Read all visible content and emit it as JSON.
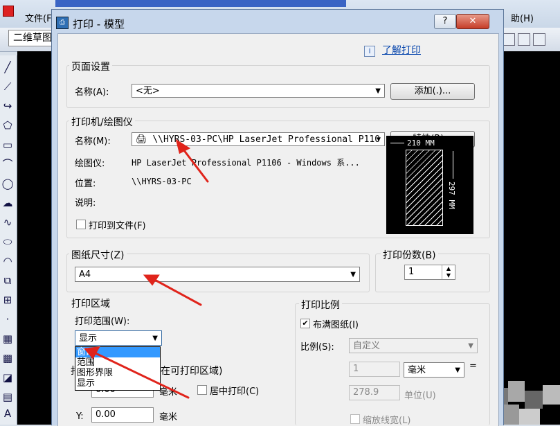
{
  "app": {
    "menu_file": "文件(F",
    "menu_help": "助(H)",
    "workspace": "二维草图"
  },
  "dialog": {
    "title": "打印 - 模型",
    "help_glyph": "?",
    "close_glyph": "✕",
    "learn_link": "了解打印",
    "info_icon": "i"
  },
  "page_setup": {
    "title": "页面设置",
    "name_label": "名称(A):",
    "name_value": "<无>",
    "add_button": "添加(.)..."
  },
  "printer": {
    "title": "打印机/绘图仪",
    "name_label": "名称(M):",
    "name_value": "\\\\HYRS-03-PC\\HP LaserJet Professional P110",
    "properties_button": "特性(R)...",
    "plotter_label": "绘图仪:",
    "plotter_value": "HP LaserJet Professional P1106 - Windows 系...",
    "location_label": "位置:",
    "location_value": "\\\\HYRS-03-PC",
    "desc_label": "说明:",
    "print_to_file": "打印到文件(F)",
    "preview_width": "210 MM",
    "preview_height": "297 MM"
  },
  "paper": {
    "title": "图纸尺寸(Z)",
    "value": "A4"
  },
  "copies": {
    "title": "打印份数(B)",
    "value": "1"
  },
  "plot_area": {
    "title": "打印区域",
    "range_label": "打印范围(W):",
    "range_value": "显示",
    "options": [
      "窗口",
      "范围",
      "图形界限",
      "显示"
    ]
  },
  "offset": {
    "title_partial": "在可打印区域)",
    "x_value": "0.00",
    "y_label": "Y:",
    "y_value": "0.00",
    "unit_mm": "毫米",
    "center_label": "居中打印(C)"
  },
  "scale": {
    "title": "打印比例",
    "fit_label": "布满图纸(I)",
    "scale_label": "比例(S):",
    "scale_value": "自定义",
    "num_value": "1",
    "unit_value": "毫米",
    "equals": "=",
    "units_value": "278.9",
    "units_label": "单位(U)",
    "lineweights": "缩放线宽(L)"
  },
  "colors": {
    "accent": "#3399ff",
    "arrow": "#e0241b"
  }
}
